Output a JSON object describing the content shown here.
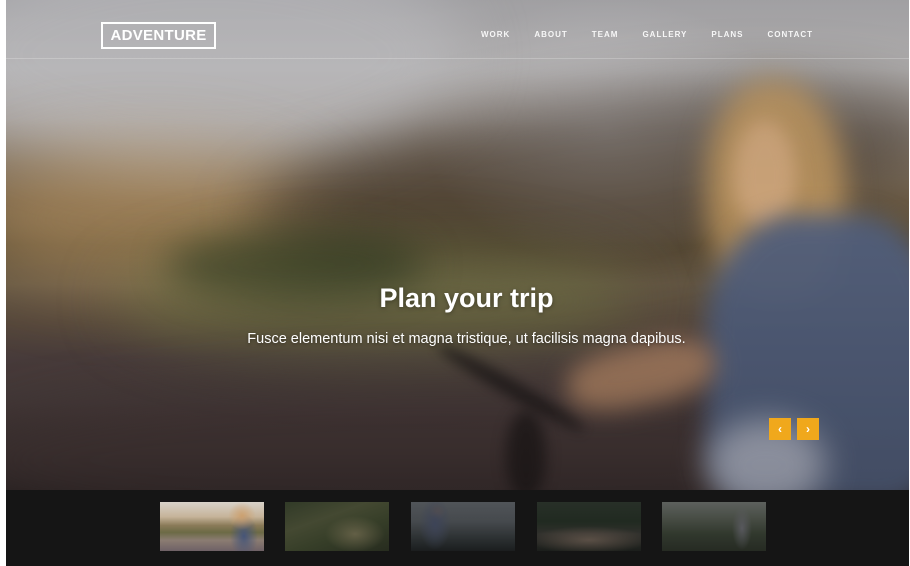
{
  "brand": {
    "logo_text": "ADVENTURE"
  },
  "nav": {
    "items": [
      {
        "label": "WORK"
      },
      {
        "label": "ABOUT"
      },
      {
        "label": "TEAM"
      },
      {
        "label": "GALLERY"
      },
      {
        "label": "PLANS"
      },
      {
        "label": "CONTACT"
      }
    ]
  },
  "hero": {
    "title": "Plan your trip",
    "subtitle": "Fusce elementum nisi et magna tristique, ut facilisis magna dapibus."
  },
  "slider": {
    "prev_glyph": "‹",
    "next_glyph": "›",
    "accent_color": "#f0a81c",
    "active_thumbnail": 1,
    "thumbnail_count": 5
  }
}
